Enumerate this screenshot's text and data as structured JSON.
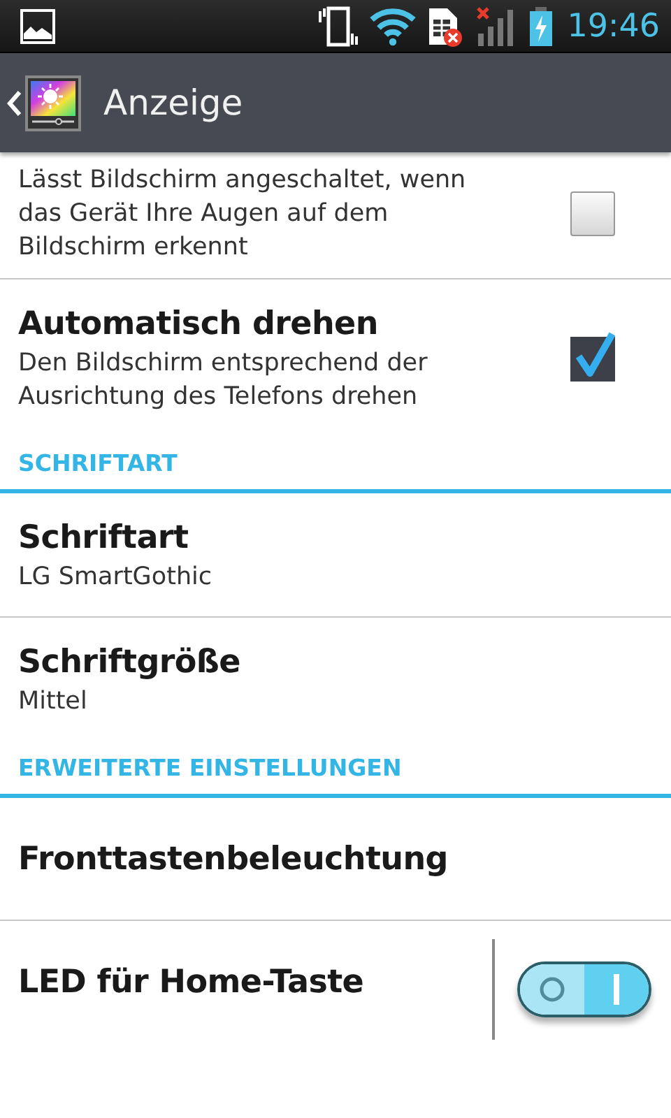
{
  "status_bar": {
    "time": "19:46"
  },
  "action_bar": {
    "title": "Anzeige"
  },
  "list": [
    {
      "kind": "checkbox",
      "summary": "Lässt Bildschirm angeschaltet, wenn das Gerät Ihre Augen auf dem Bildschirm erkennt",
      "checked": false
    },
    {
      "kind": "checkbox",
      "title": "Automatisch drehen",
      "summary": "Den Bildschirm entsprechend der Ausrichtung des Telefons drehen",
      "checked": true
    },
    {
      "kind": "header",
      "title": "SCHRIFTART"
    },
    {
      "kind": "plain",
      "title": "Schriftart",
      "summary": "LG SmartGothic"
    },
    {
      "kind": "plain",
      "title": "Schriftgröße",
      "summary": "Mittel"
    },
    {
      "kind": "header",
      "title": "ERWEITERTE EINSTELLUNGEN"
    },
    {
      "kind": "plain",
      "title": "Fronttastenbeleuchtung"
    },
    {
      "kind": "switch",
      "title": "LED für Home-Taste",
      "on": true
    }
  ]
}
